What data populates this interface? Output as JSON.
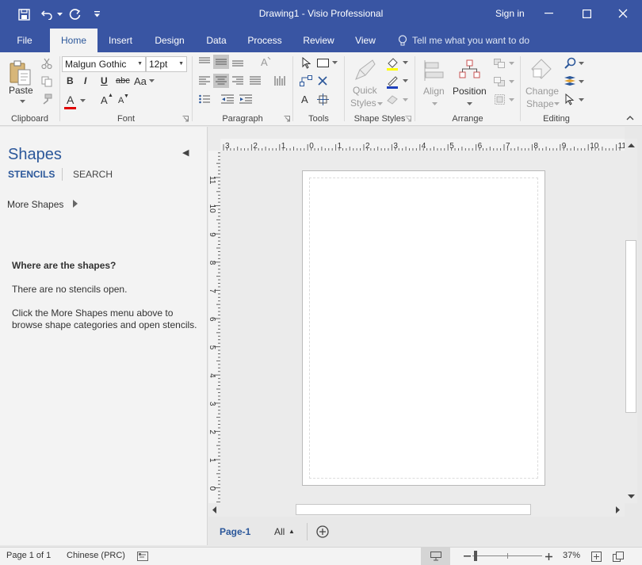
{
  "window": {
    "title": "Drawing1 - Visio Professional",
    "sign_in": "Sign in"
  },
  "tabs": [
    "File",
    "Home",
    "Insert",
    "Design",
    "Data",
    "Process",
    "Review",
    "View"
  ],
  "active_tab": "Home",
  "tell_me": "Tell me what you want to do",
  "ribbon": {
    "clipboard": {
      "label": "Clipboard",
      "paste": "Paste"
    },
    "font": {
      "label": "Font",
      "font_name": "Malgun Gothic",
      "font_size": "12pt",
      "bold": "B",
      "italic": "I",
      "underline": "U",
      "strike": "abc",
      "change_case": "Aa",
      "font_color": "A",
      "grow": "A",
      "shrink": "A"
    },
    "paragraph": {
      "label": "Paragraph"
    },
    "tools": {
      "label": "Tools",
      "text": "A"
    },
    "shape_styles": {
      "label": "Shape Styles",
      "quick1": "Quick",
      "quick2": "Styles"
    },
    "arrange": {
      "label": "Arrange",
      "align": "Align",
      "position": "Position"
    },
    "editing": {
      "label": "Editing",
      "change1": "Change",
      "change2": "Shape"
    }
  },
  "shapes_pane": {
    "title": "Shapes",
    "tab_stencils": "STENCILS",
    "tab_search": "SEARCH",
    "more_shapes": "More Shapes",
    "heading": "Where are the shapes?",
    "line1": "There are no stencils open.",
    "line2a": "Click the More Shapes menu above to",
    "line2b": "browse shape categories and open stencils."
  },
  "ruler": {
    "top": [
      "3",
      "2",
      "1",
      "0",
      "1",
      "2",
      "3",
      "4",
      "5",
      "6",
      "7",
      "8",
      "9",
      "10",
      "11"
    ],
    "left": [
      "11",
      "10",
      "9",
      "8",
      "7",
      "6",
      "5",
      "4",
      "3",
      "2",
      "1",
      "0"
    ]
  },
  "page_tabs": {
    "page": "Page-1",
    "all": "All"
  },
  "status": {
    "page": "Page 1 of 1",
    "language": "Chinese (PRC)",
    "zoom": "37%"
  },
  "colors": {
    "accent": "#3955a3",
    "highlight": "#ffff00",
    "font_red": "#e00000",
    "line_blue": "#1d3fbb"
  },
  "icons": [
    "save-icon",
    "undo-icon",
    "redo-icon",
    "customize-icon",
    "minimize-icon",
    "maximize-icon",
    "close-icon",
    "lightbulb-icon",
    "paste-icon",
    "cut-icon",
    "copy-icon",
    "format-painter-icon",
    "zoom-in-icon",
    "zoom-out-icon",
    "fit-page-icon",
    "switch-windows-icon",
    "add-page-icon",
    "presentation-mode-icon",
    "macro-icon"
  ]
}
